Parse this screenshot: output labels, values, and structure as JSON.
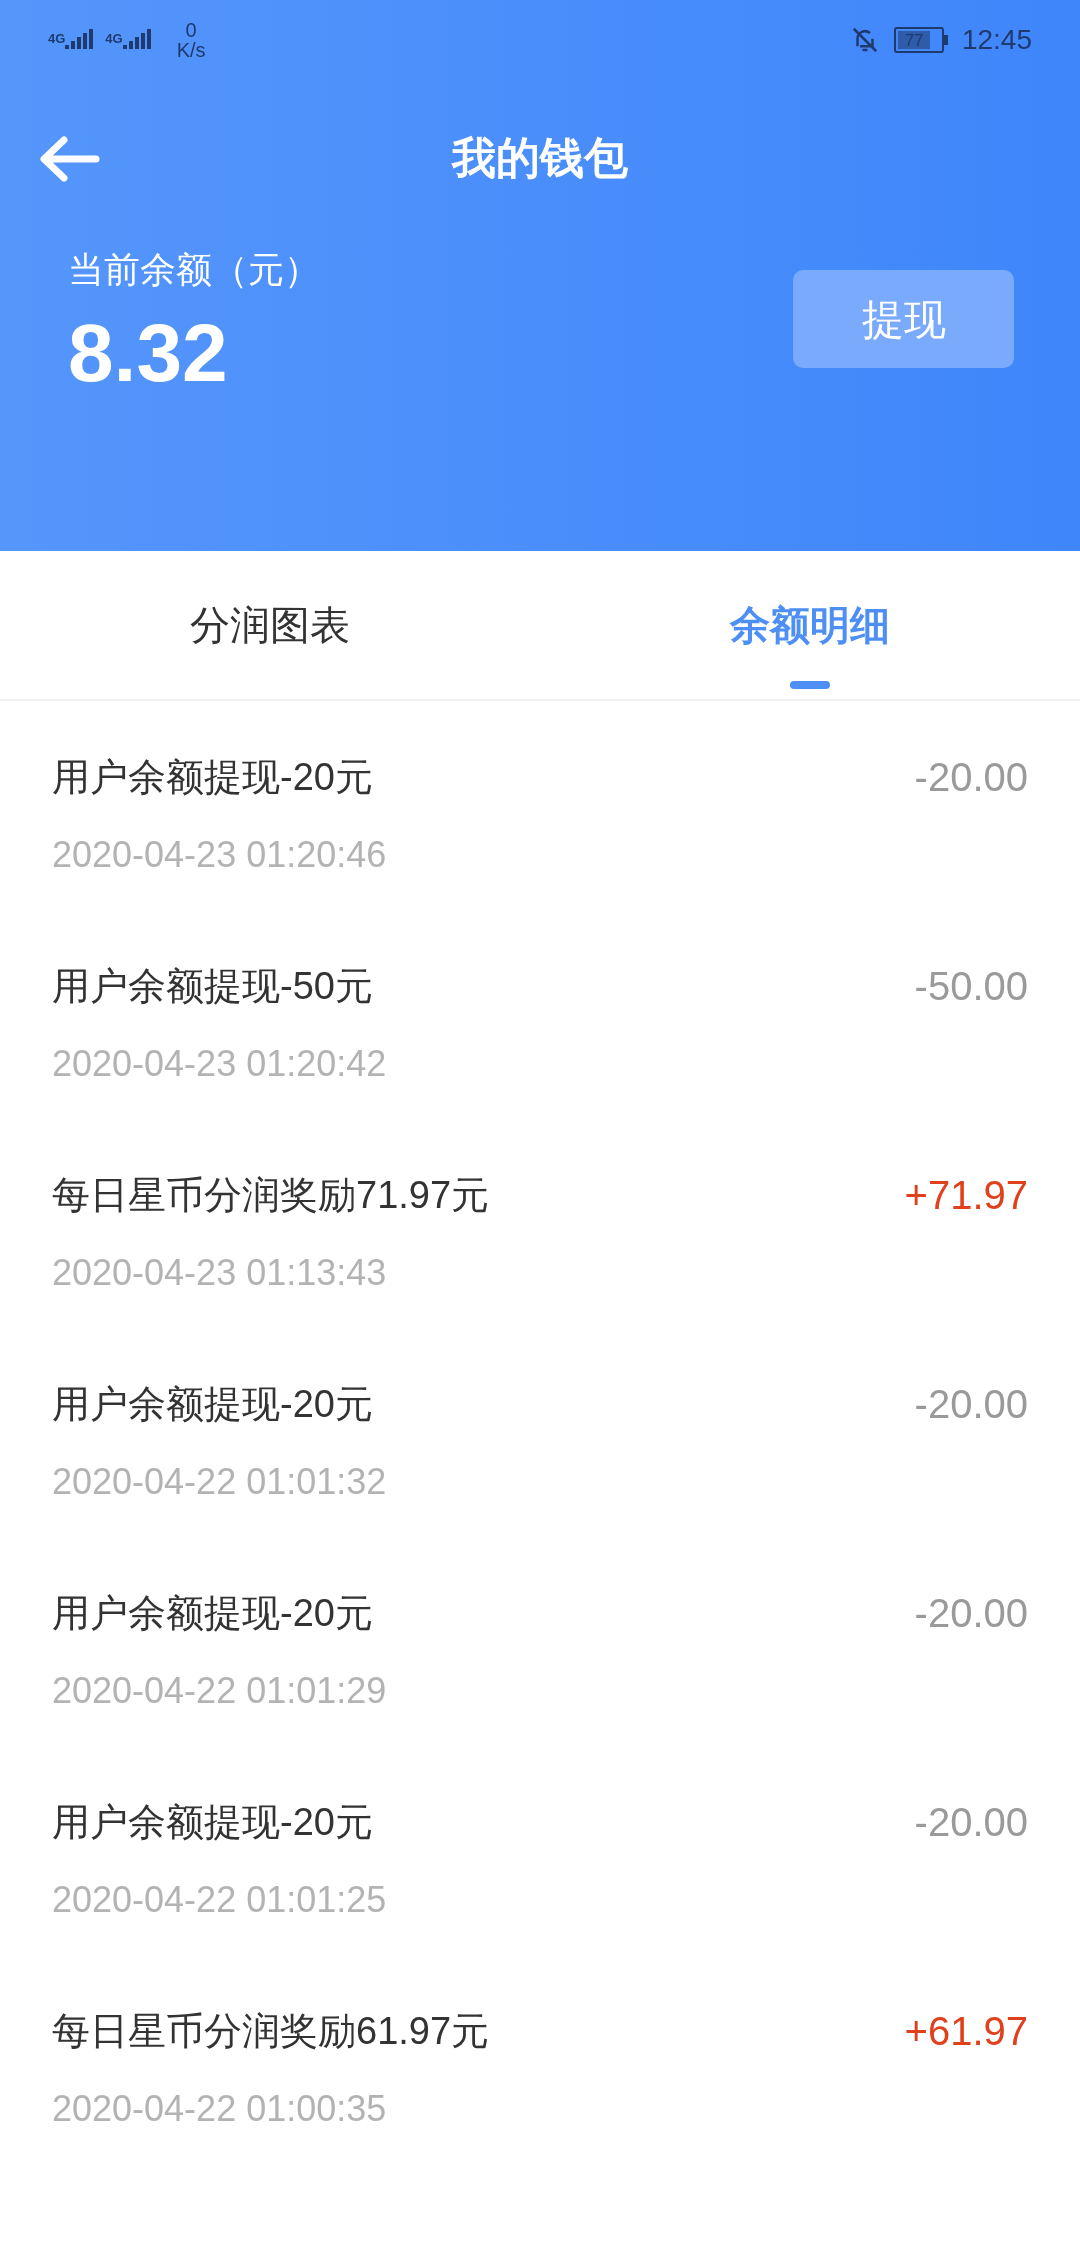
{
  "status_bar": {
    "signal_labels": [
      "4G",
      "4G"
    ],
    "speed_value": "0",
    "speed_unit": "K/s",
    "battery": "77",
    "time": "12:45"
  },
  "header": {
    "title": "我的钱包",
    "balance_label": "当前余额（元）",
    "balance": "8.32",
    "withdraw_button": "提现"
  },
  "tabs": [
    {
      "label": "分润图表",
      "selected": false
    },
    {
      "label": "余额明细",
      "selected": true
    }
  ],
  "transactions": [
    {
      "title": "用户余额提现-20元",
      "time": "2020-04-23 01:20:46",
      "amount": "-20.00",
      "kind": "debit"
    },
    {
      "title": "用户余额提现-50元",
      "time": "2020-04-23 01:20:42",
      "amount": "-50.00",
      "kind": "debit"
    },
    {
      "title": "每日星币分润奖励71.97元",
      "time": "2020-04-23 01:13:43",
      "amount": "+71.97",
      "kind": "credit"
    },
    {
      "title": "用户余额提现-20元",
      "time": "2020-04-22 01:01:32",
      "amount": "-20.00",
      "kind": "debit"
    },
    {
      "title": "用户余额提现-20元",
      "time": "2020-04-22 01:01:29",
      "amount": "-20.00",
      "kind": "debit"
    },
    {
      "title": "用户余额提现-20元",
      "time": "2020-04-22 01:01:25",
      "amount": "-20.00",
      "kind": "debit"
    },
    {
      "title": "每日星币分润奖励61.97元",
      "time": "2020-04-22 01:00:35",
      "amount": "+61.97",
      "kind": "credit"
    }
  ]
}
